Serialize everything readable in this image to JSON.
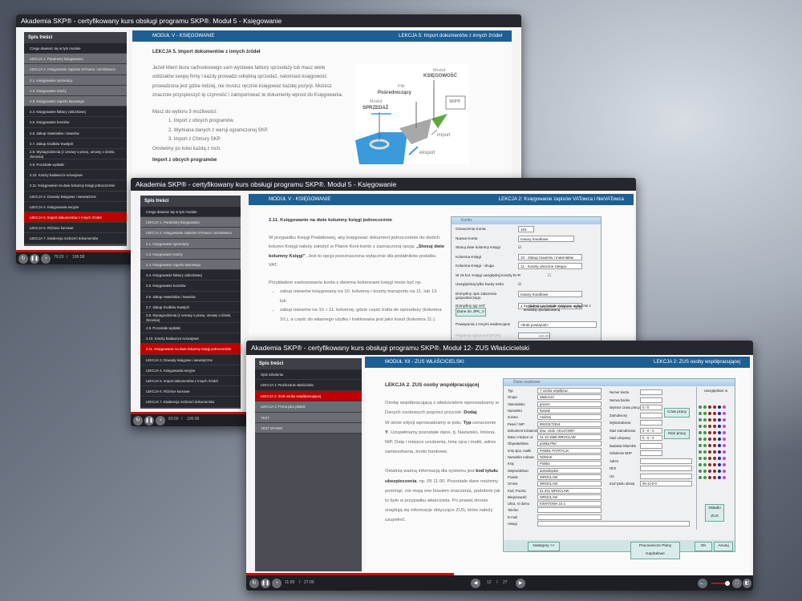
{
  "windows": [
    {
      "title": "Akademia SKP® - certyfikowany kurs obsługi programu SKP®. Moduł 5 - Księgowanie",
      "toc_title": "Spis treści",
      "toc": [
        "Czego dowiesz się w tym module",
        "LEKCJA 1. Parametry księgowania",
        "LEKCJA 2. Księgowanie zapisów VATowca i nieVatowca",
        "2.1. Księgowanie sprzedaży",
        "2.2. Księgowanie marży",
        "2.3. Księgowanie raportu kasowego",
        "2.4. Księgowanie faktury zaliczkowej",
        "2.5. Księgowanie kosztów",
        "2.6. Zakup materiałów i towarów",
        "2.7. Zakup środków trwałych",
        "2.8. Wynagrodzenia (z umowy o pracę, umowy o dzieło, zlecenia)",
        "2.9. Pozostałe wydatki",
        "2.10. Koszty badawczo-rozwojowe",
        "2.11. Księgowanie na dwie kolumny księgi jednocześnie",
        "LEKCJA 3. Dowody księgowe i wewnętrzne",
        "LEKCJA 4. Księgowania seryjne",
        "LEKCJA 5. Import dokumentów z innych źródeł",
        "LEKCJA 6. Różnice kursowe",
        "LEKCJA 7. Ewidencja rozliczeń dokumentów"
      ],
      "module": "MODUŁ V - KSIĘGOWANIE",
      "lesson": "LEKCJA 5: Import dokumentów z innych źródeł",
      "heading": "LEKCJA 5. Import dokumentów z innych źródeł",
      "para": "Jeżeli klient biura rachunkowego sam wystawia faktury sprzedaży lub masz wiele oddziałów swojej firmy i każdy prowadzi odrębną sprzedaż, natomiast księgowość prowadzona jest gdzie indziej, nie musisz ręcznie księgować każdej pozycji. Możesz znacznie przyspieszyć tę czynność i zaimportować te dokumenty wprost do Księgowania.",
      "choices_intro": "Masz do wyboru 3 możliwości:",
      "choices": [
        "1. Import z obcych programów.",
        "2. Wymiana danych z wersji ograniczonej SKP.",
        "3. Import z Chmury SKP."
      ],
      "outro": "Omówimy po kolei każdą z nich.",
      "subheading": "Import z obcych programów",
      "diagram": {
        "m1a": "Moduł",
        "m1b": "SPRZEDAŻ",
        "p1": "Plik",
        "p2": "Pośredniczący",
        "m2a": "Moduł",
        "m2b": "KSIĘGOWOŚĆ",
        "skp": "SKP®",
        "imp": "import",
        "exp": "eksport"
      },
      "time": "79:20",
      "total": "106:58"
    },
    {
      "title": "Akademia SKP® - certyfikowany kurs obsługi programu SKP®. Moduł 5 - Księgowanie",
      "module": "MODUŁ V - KSIĘGOWANIE",
      "lesson": "LEKCJA 2: Księgowanie zapisów VATowca i NieVATowca",
      "heading": "2.11. Księgowanie na dwie kolumny księgi jednocześnie",
      "p1a": "W przypadku Księgi Podatkowej, aby księgować dokument jednocześnie do dwóch kolumn Księgi należy założyć w Planie Kont konto z zaznaczoną opcją: ",
      "p1b": "„Stosuj dwie kolumny Księgi”",
      "p1c": ". Jest to opcja przeznaczona wyłącznie dla podatników podatku VAT.",
      "p2": "Przykładem zastosowania konta z dwiema kolumnami księgi może być np.",
      "bullets": [
        "zakup towarów księgowany na 10. kolumnę i koszty transportu na 11. lub 13. lub",
        "zakup towarów na 10. i 11. kolumnę, gdzie część trafia do sprzedaży (kolumna 10.), a część do własnego użytku i traktowana jest jako koszt (kolumna 11.)."
      ],
      "dialog": {
        "title": "Konto",
        "rows": [
          [
            "Oznaczenie Konta",
            "104"
          ],
          [
            "Nazwa Konta",
            "towary handlowe"
          ],
          [
            "Stosuj dwie kolumny Księgi",
            "☑"
          ],
          [
            "Kolumna Księgi",
            "10 - Zakup towarów i materiałów"
          ],
          [
            "Kolumna Księgi - druga",
            "11 - Koszty uboczne zakupu"
          ],
          [
            "W 16 kol. Księgi uwzględnij Koszty B+R",
            "☐"
          ],
          [
            "Uwzględniaj tylko kwoty netto",
            "☑"
          ],
          [
            "Domyślny opis zdarzenia gospodarczego",
            "towary handlowe"
          ],
          [
            "Domyślny typ VAT",
            "4 - Nabycia pozostałe związane wyłącznie"
          ]
        ],
        "vat_note": "4 - Nabycia pozostałe związane wyłącznie z dostawą opodatkowaną",
        "jpk": "Dane do JPK_V",
        "link_label": "Powiązania z innymi ewidencjami",
        "link_value": "<brak powiązań>",
        "prop_label": "Proporcja ujęcia w KUP [%]",
        "prop_value": "100,00"
      },
      "time": "63:50",
      "total": "106:58"
    },
    {
      "title": "Akademia SKP® - certyfikowany kurs obsługi programu SKP®. Moduł 12- ZUS Właścicielski",
      "toc": [
        "Opis szkolenia",
        "LEKCJA 1: Rozliczanie właściciela",
        "LEKCJA 2: ZUS osoby współpracującej",
        "LEKCJA 3: Firma jako płatnik",
        "TEST",
        "TEST WYNIKI"
      ],
      "module": "MODUŁ XII - ZUS WŁAŚCICIELSKI",
      "lesson": "LEKCJA 2: ZUS osoby współpracującej",
      "heading": "LEKCJA 2. ZUS osoby współpracującej",
      "p1a": "Osobę współpracującą z właścicielem wprowadzamy w Danych osobowych poprzez przycisk: ",
      "p1b": "Dodaj",
      "p1c": ".",
      "p2a": "W oknie edycji wprowadzamy w polu: ",
      "p2b": "Typ",
      "p2c": " oznaczenie ",
      "p2d": "Y",
      "p2e": ". Uzupełniamy pozostałe dane, tj. Nazwisko, Imiona, NIP, Datę i miejsce urodzenia, Imię ojca i matki, adres zamieszkania, konto bankowe.",
      "p3a": "Ostatnią ważną informacją dla systemu jest ",
      "p3b": "kod tytułu ubezpieczenia",
      "p3c": ", np. 05 11 00. Pozostałe dane możemy pominąć, nie mają one bowiem znaczenia, podobnie jak to było w przypadku właściciela. Po prawej stronie znajdują się informacje dotyczące ZUS, które należy uzupełnić.",
      "form": {
        "title": "Dane osobowe",
        "left": [
          [
            "Typ",
            "Y  osoba współprac."
          ],
          [
            "Grupa",
            "właściciel"
          ],
          [
            "Stanowisko",
            "prezes"
          ],
          [
            "Nazwisko",
            "Nowak"
          ],
          [
            "Imiona",
            "Andrzej"
          ],
          [
            "Pesel / NIP",
            "89103172914"
          ],
          [
            "Dokument tożsamości",
            "dow. osob.  AKU272697"
          ],
          [
            "Data i miejsce ur.",
            "31-10-1988  WROCŁAW"
          ],
          [
            "Obywatelstwo",
            "polska  Płeć"
          ],
          [
            "Imię ojca, matki",
            "PAWEŁ  PATRYCJA"
          ],
          [
            "Nazwisko rodowe",
            "NOWAK"
          ],
          [
            "Kraj",
            "Polska"
          ],
          [
            "Województwo",
            "dolnośląskie"
          ],
          [
            "Powiat",
            "WROCŁAW"
          ],
          [
            "Gmina",
            "WROCŁAW"
          ],
          [
            "Kod, Poczta",
            "51-251  WROCŁAW"
          ],
          [
            "Miejscowość",
            "WROCŁAW"
          ],
          [
            "Ulica, nr domu",
            "KWIATOWA  15  2"
          ],
          [
            "Telefon",
            ""
          ],
          [
            "E-mail",
            ""
          ],
          [
            "Uwagi",
            ""
          ]
        ],
        "right": [
          [
            "Numer konta",
            ""
          ],
          [
            "Nazwa banku",
            ""
          ],
          [
            "Wymiar czasu pracy",
            "0 / 0"
          ],
          [
            "Zatrudniony",
            ""
          ],
          [
            "Wykształcenie",
            ""
          ],
          [
            "Staż zatrudnienia",
            "0 - 0 - 0"
          ],
          [
            "Staż urlopowy",
            "0 - 0 - 0"
          ],
          [
            "Badania lekarskie",
            ""
          ],
          [
            "Szkolenie BHP",
            ""
          ],
          [
            "Adres",
            ""
          ],
          [
            "NFZ",
            ""
          ],
          [
            "US",
            ""
          ],
          [
            "Kod tytułu ubezp.",
            "05-11-0-0"
          ]
        ],
        "czas_btn": "Czas pracy",
        "staz_btn": "Staż pracy",
        "skladki_btn": "Składki ZUS",
        "next_btn": "Następny >>",
        "ppk_btn": "Pracownicze Plany Kapitałowe",
        "ok_btn": "OK",
        "cancel_btn": "Anuluj",
        "uwzgl": "Uwzględniać w"
      },
      "time": "11:09",
      "total": "27:00",
      "page": "12",
      "pages": "27"
    }
  ]
}
